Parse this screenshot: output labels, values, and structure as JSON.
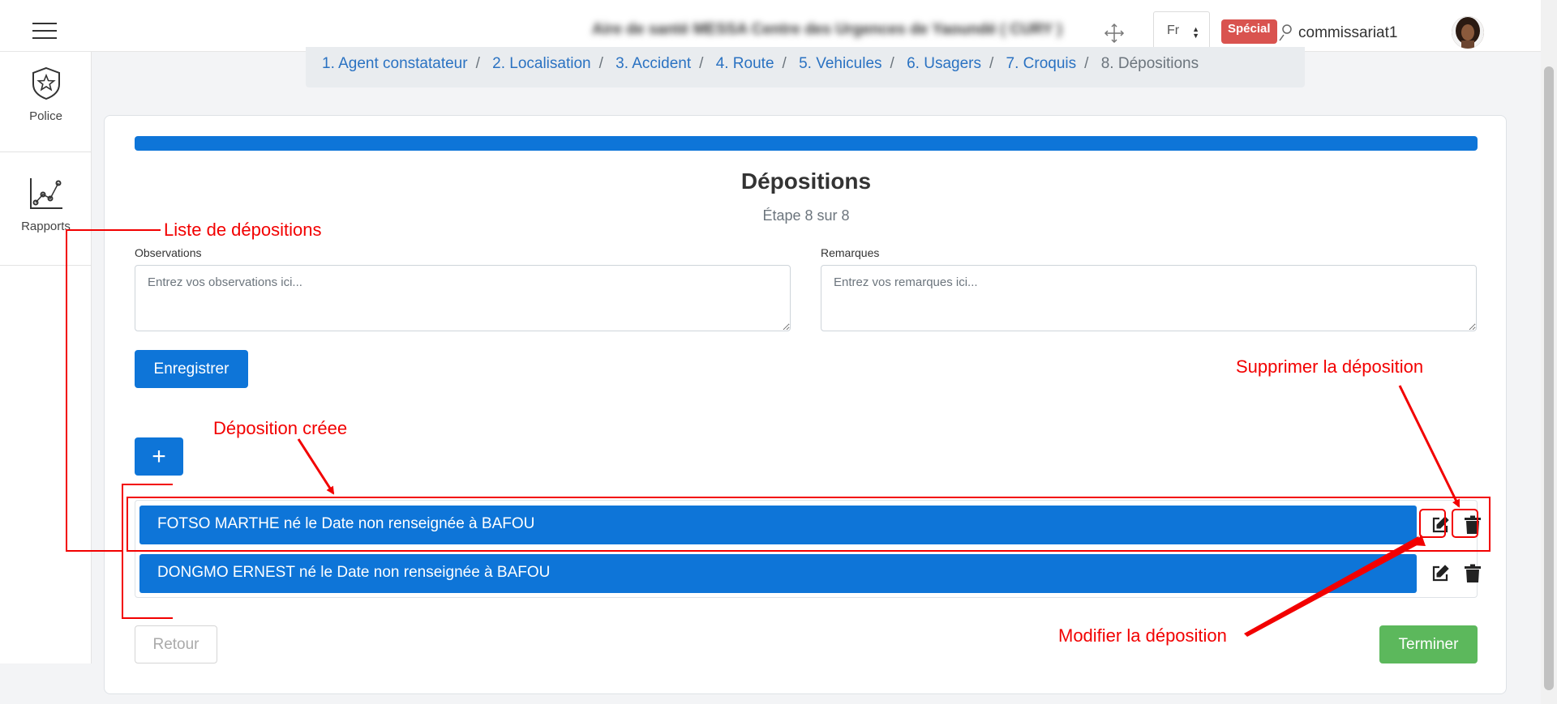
{
  "header": {
    "site_name": "Aire de santé MESSA Centre des Urgences de Yaoundé ( CURY )",
    "language": "Fr",
    "badge": "Spécial",
    "username": "commissariat1"
  },
  "sidebar": {
    "items": [
      {
        "label": "Police",
        "icon": "police-star-badge-icon"
      },
      {
        "label": "Rapports",
        "icon": "line-chart-icon"
      }
    ]
  },
  "steps": [
    {
      "label": "1. Agent constatateur"
    },
    {
      "label": "2. Localisation"
    },
    {
      "label": "3. Accident"
    },
    {
      "label": "4. Route"
    },
    {
      "label": "5. Vehicules"
    },
    {
      "label": "6. Usagers"
    },
    {
      "label": "7. Croquis"
    },
    {
      "label": "8. Dépositions"
    }
  ],
  "form": {
    "progress": 1.0,
    "title": "Dépositions",
    "step_text": "Étape 8 sur 8",
    "observations_label": "Observations",
    "observations_placeholder": "Entrez vos observations ici...",
    "remarques_label": "Remarques",
    "remarques_placeholder": "Entrez vos remarques ici...",
    "save_label": "Enregistrer",
    "add_label": "+",
    "back_label": "Retour",
    "finish_label": "Terminer"
  },
  "depositions": [
    {
      "text": "FOTSO MARTHE né le Date non renseignée à BAFOU"
    },
    {
      "text": "DONGMO ERNEST né le Date non renseignée à BAFOU"
    }
  ],
  "annotations": {
    "list": "Liste de dépositions",
    "created": "Déposition créee",
    "delete": "Supprimer la déposition",
    "edit": "Modifier la déposition",
    "color": "#f20000"
  },
  "colors": {
    "primary": "#0e75d8",
    "success": "#5cb85c",
    "danger_badge": "#d9534f",
    "link": "#2a72c2"
  }
}
